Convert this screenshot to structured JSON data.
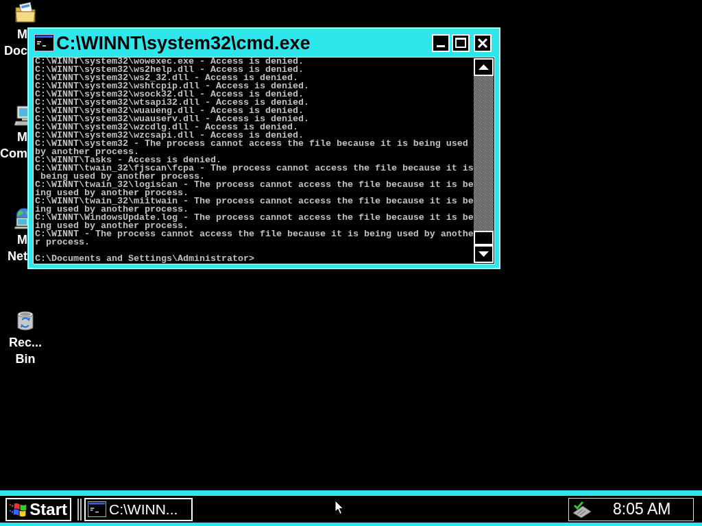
{
  "desktop_icons": [
    {
      "kind": "folder",
      "label": [
        "M",
        "Doc"
      ]
    },
    {
      "kind": "computer",
      "label": [
        "M",
        "Com"
      ]
    },
    {
      "kind": "network",
      "label": [
        "M",
        "Net"
      ]
    },
    {
      "kind": "recycle_bin",
      "label": [
        "Rec...",
        "Bin"
      ]
    }
  ],
  "window": {
    "title": "C:\\WINNT\\system32\\cmd.exe",
    "output_lines": [
      "C:\\WINNT\\system32\\wowexec.exe - Access is denied.",
      "C:\\WINNT\\system32\\ws2help.dll - Access is denied.",
      "C:\\WINNT\\system32\\ws2_32.dll - Access is denied.",
      "C:\\WINNT\\system32\\wshtcpip.dll - Access is denied.",
      "C:\\WINNT\\system32\\wsock32.dll - Access is denied.",
      "C:\\WINNT\\system32\\wtsapi32.dll - Access is denied.",
      "C:\\WINNT\\system32\\wuaueng.dll - Access is denied.",
      "C:\\WINNT\\system32\\wuauserv.dll - Access is denied.",
      "C:\\WINNT\\system32\\wzcdlg.dll - Access is denied.",
      "C:\\WINNT\\system32\\wzcsapi.dll - Access is denied.",
      "C:\\WINNT\\system32 - The process cannot access the file because it is being used",
      "by another process.",
      "C:\\WINNT\\Tasks - Access is denied.",
      "C:\\WINNT\\twain_32\\fjscan\\fcpa - The process cannot access the file because it is",
      " being used by another process.",
      "C:\\WINNT\\twain_32\\logiscan - The process cannot access the file because it is be",
      "ing used by another process.",
      "C:\\WINNT\\twain_32\\miitwain - The process cannot access the file because it is be",
      "ing used by another process.",
      "C:\\WINNT\\WindowsUpdate.log - The process cannot access the file because it is be",
      "ing used by another process.",
      "C:\\WINNT - The process cannot access the file because it is being used by anothe",
      "r process."
    ],
    "prompt": "C:\\Documents and Settings\\Administrator>"
  },
  "taskbar": {
    "start_label": "Start",
    "tasks": [
      {
        "label": "C:\\WINN..."
      }
    ],
    "clock": "8:05 AM"
  }
}
